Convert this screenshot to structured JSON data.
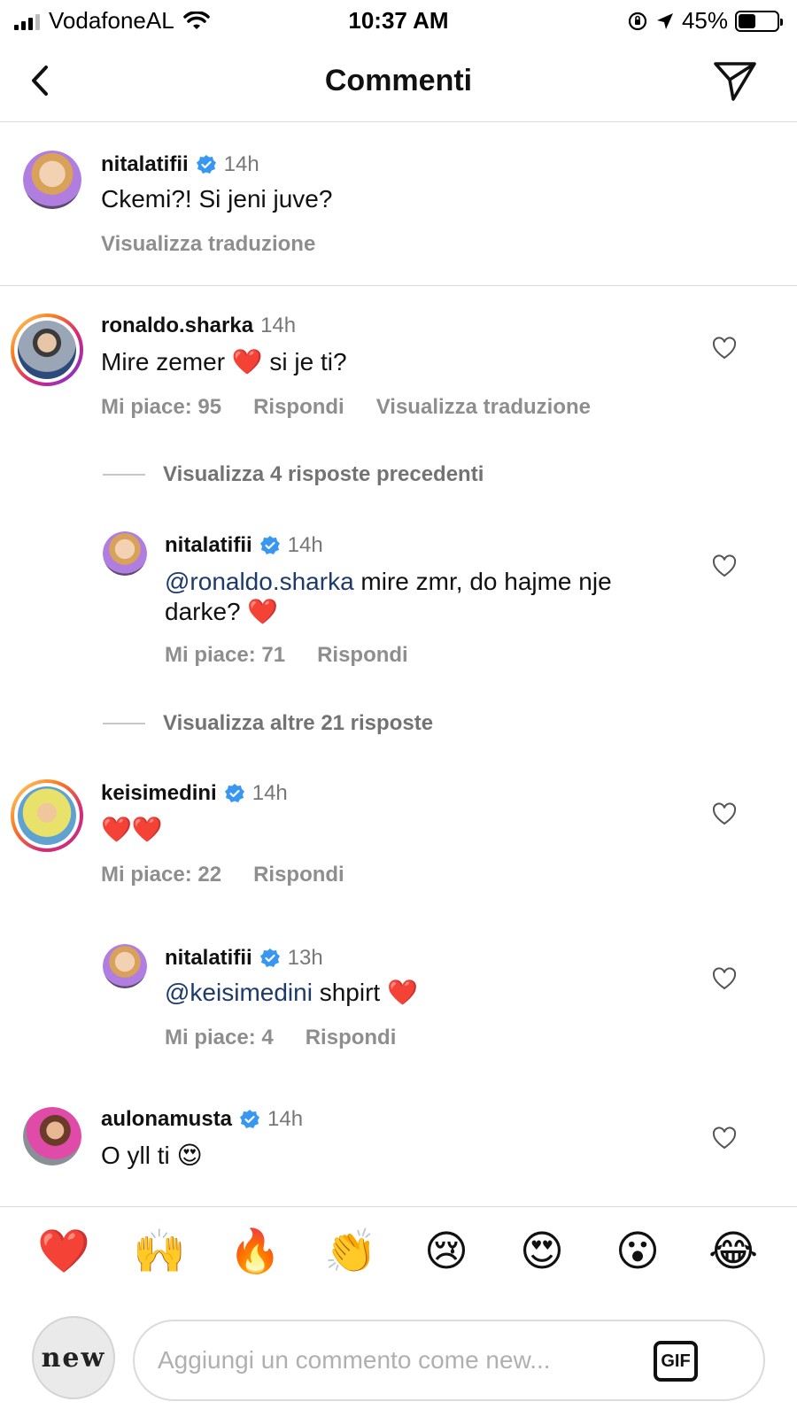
{
  "status_bar": {
    "carrier": "VodafoneAL",
    "time": "10:37 AM",
    "battery": "45%",
    "battery_level": 0.45
  },
  "header": {
    "title": "Commenti"
  },
  "comments": [
    {
      "username": "nitalatifii",
      "verified": true,
      "time": "14h",
      "text": "Ckemi?! Si jeni juve?",
      "translate": "Visualizza traduzione"
    },
    {
      "username": "ronaldo.sharka",
      "verified": false,
      "time": "14h",
      "text": "Mire zemer ❤️ si je ti?",
      "likes": "Mi piace: 95",
      "reply": "Rispondi",
      "translate": "Visualizza traduzione",
      "view_previous": "Visualizza 4 risposte precedenti",
      "replies": [
        {
          "username": "nitalatifii",
          "verified": true,
          "time": "14h",
          "mention": "@ronaldo.sharka",
          "text": " mire zmr, do hajme nje darke? ❤️",
          "likes": "Mi piace: 71",
          "reply": "Rispondi"
        }
      ],
      "view_more": "Visualizza altre 21 risposte"
    },
    {
      "username": "keisimedini",
      "verified": true,
      "time": "14h",
      "text": "❤️❤️",
      "likes": "Mi piace: 22",
      "reply": "Rispondi",
      "replies": [
        {
          "username": "nitalatifii",
          "verified": true,
          "time": "13h",
          "mention": "@keisimedini",
          "text": " shpirt ❤️",
          "likes": "Mi piace: 4",
          "reply": "Rispondi"
        }
      ]
    },
    {
      "username": "aulonamusta",
      "verified": true,
      "time": "14h",
      "text": "O yll ti 😍"
    }
  ],
  "emoji_bar": [
    "❤️",
    "🙌",
    "🔥",
    "👏",
    "😢",
    "😍",
    "😮",
    "😂"
  ],
  "composer": {
    "avatar_text": "new",
    "placeholder": "Aggiungi un commento come new...",
    "gif_label": "GIF"
  },
  "colors": {
    "verified": "#3897f0",
    "mention": "#1c3a6b",
    "muted": "#8e8e8e"
  }
}
